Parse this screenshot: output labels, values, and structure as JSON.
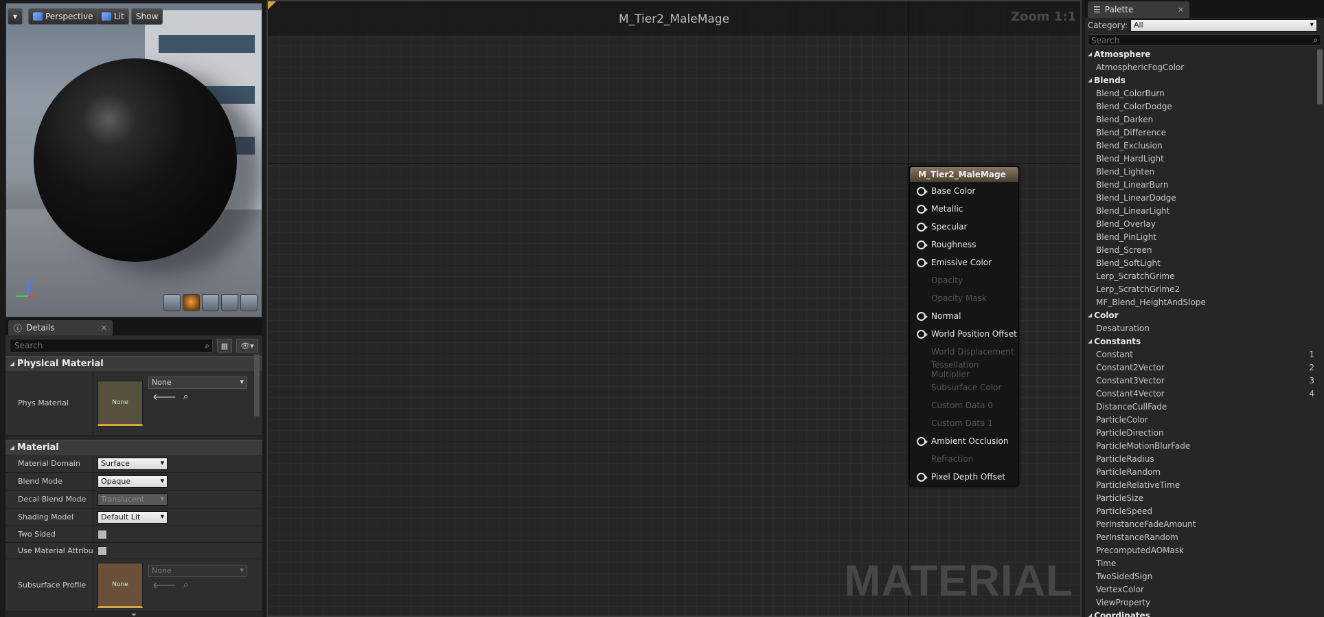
{
  "viewport": {
    "buttons": {
      "menu": "▾",
      "perspective": "Perspective",
      "lit": "Lit",
      "show": "Show"
    },
    "axis": {
      "z": "Z",
      "x": "x",
      "y": "y"
    }
  },
  "details": {
    "tab_label": "Details",
    "search_placeholder": "Search",
    "physical_material": {
      "header": "Physical Material",
      "phys_material_label": "Phys Material",
      "thumb_label": "None",
      "combo_value": "None"
    },
    "material": {
      "header": "Material",
      "rows": [
        {
          "label": "Material Domain",
          "value": "Surface"
        },
        {
          "label": "Blend Mode",
          "value": "Opaque"
        },
        {
          "label": "Decal Blend Mode",
          "value": "Translucent"
        },
        {
          "label": "Shading Model",
          "value": "Default Lit"
        }
      ],
      "two_sided_label": "Two Sided",
      "use_attrs_label": "Use Material Attributes",
      "subsurface_label": "Subsurface Profile",
      "subsurface_thumb": "None",
      "subsurface_value": "None"
    }
  },
  "graph": {
    "title": "M_Tier2_MaleMage",
    "zoom": "Zoom 1:1",
    "watermark": "MATERIAL",
    "node": {
      "title": "M_Tier2_MaleMage",
      "pins": [
        {
          "label": "Base Color",
          "enabled": true
        },
        {
          "label": "Metallic",
          "enabled": true
        },
        {
          "label": "Specular",
          "enabled": true
        },
        {
          "label": "Roughness",
          "enabled": true
        },
        {
          "label": "Emissive Color",
          "enabled": true
        },
        {
          "label": "Opacity",
          "enabled": false
        },
        {
          "label": "Opacity Mask",
          "enabled": false
        },
        {
          "label": "Normal",
          "enabled": true
        },
        {
          "label": "World Position Offset",
          "enabled": true
        },
        {
          "label": "World Displacement",
          "enabled": false
        },
        {
          "label": "Tessellation Multiplier",
          "enabled": false
        },
        {
          "label": "Subsurface Color",
          "enabled": false
        },
        {
          "label": "Custom Data 0",
          "enabled": false
        },
        {
          "label": "Custom Data 1",
          "enabled": false
        },
        {
          "label": "Ambient Occlusion",
          "enabled": true
        },
        {
          "label": "Refraction",
          "enabled": false
        },
        {
          "label": "Pixel Depth Offset",
          "enabled": true
        }
      ]
    }
  },
  "palette": {
    "tab_label": "Palette",
    "category_label": "Category:",
    "category_value": "All",
    "search_placeholder": "Search",
    "groups": [
      {
        "name": "Atmosphere",
        "items": [
          {
            "label": "AtmosphericFogColor",
            "shortcut": ""
          }
        ]
      },
      {
        "name": "Blends",
        "items": [
          {
            "label": "Blend_ColorBurn",
            "shortcut": ""
          },
          {
            "label": "Blend_ColorDodge",
            "shortcut": ""
          },
          {
            "label": "Blend_Darken",
            "shortcut": ""
          },
          {
            "label": "Blend_Difference",
            "shortcut": ""
          },
          {
            "label": "Blend_Exclusion",
            "shortcut": ""
          },
          {
            "label": "Blend_HardLight",
            "shortcut": ""
          },
          {
            "label": "Blend_Lighten",
            "shortcut": ""
          },
          {
            "label": "Blend_LinearBurn",
            "shortcut": ""
          },
          {
            "label": "Blend_LinearDodge",
            "shortcut": ""
          },
          {
            "label": "Blend_LinearLight",
            "shortcut": ""
          },
          {
            "label": "Blend_Overlay",
            "shortcut": ""
          },
          {
            "label": "Blend_PinLight",
            "shortcut": ""
          },
          {
            "label": "Blend_Screen",
            "shortcut": ""
          },
          {
            "label": "Blend_SoftLight",
            "shortcut": ""
          },
          {
            "label": "Lerp_ScratchGrime",
            "shortcut": ""
          },
          {
            "label": "Lerp_ScratchGrime2",
            "shortcut": ""
          },
          {
            "label": "MF_Blend_HeightAndSlope",
            "shortcut": ""
          }
        ]
      },
      {
        "name": "Color",
        "items": [
          {
            "label": "Desaturation",
            "shortcut": ""
          }
        ]
      },
      {
        "name": "Constants",
        "items": [
          {
            "label": "Constant",
            "shortcut": "1"
          },
          {
            "label": "Constant2Vector",
            "shortcut": "2"
          },
          {
            "label": "Constant3Vector",
            "shortcut": "3"
          },
          {
            "label": "Constant4Vector",
            "shortcut": "4"
          },
          {
            "label": "DistanceCullFade",
            "shortcut": ""
          },
          {
            "label": "ParticleColor",
            "shortcut": ""
          },
          {
            "label": "ParticleDirection",
            "shortcut": ""
          },
          {
            "label": "ParticleMotionBlurFade",
            "shortcut": ""
          },
          {
            "label": "ParticleRadius",
            "shortcut": ""
          },
          {
            "label": "ParticleRandom",
            "shortcut": ""
          },
          {
            "label": "ParticleRelativeTime",
            "shortcut": ""
          },
          {
            "label": "ParticleSize",
            "shortcut": ""
          },
          {
            "label": "ParticleSpeed",
            "shortcut": ""
          },
          {
            "label": "PerInstanceFadeAmount",
            "shortcut": ""
          },
          {
            "label": "PerInstanceRandom",
            "shortcut": ""
          },
          {
            "label": "PrecomputedAOMask",
            "shortcut": ""
          },
          {
            "label": "Time",
            "shortcut": ""
          },
          {
            "label": "TwoSidedSign",
            "shortcut": ""
          },
          {
            "label": "VertexColor",
            "shortcut": ""
          },
          {
            "label": "ViewProperty",
            "shortcut": ""
          }
        ]
      },
      {
        "name": "Coordinates",
        "items": []
      }
    ]
  }
}
